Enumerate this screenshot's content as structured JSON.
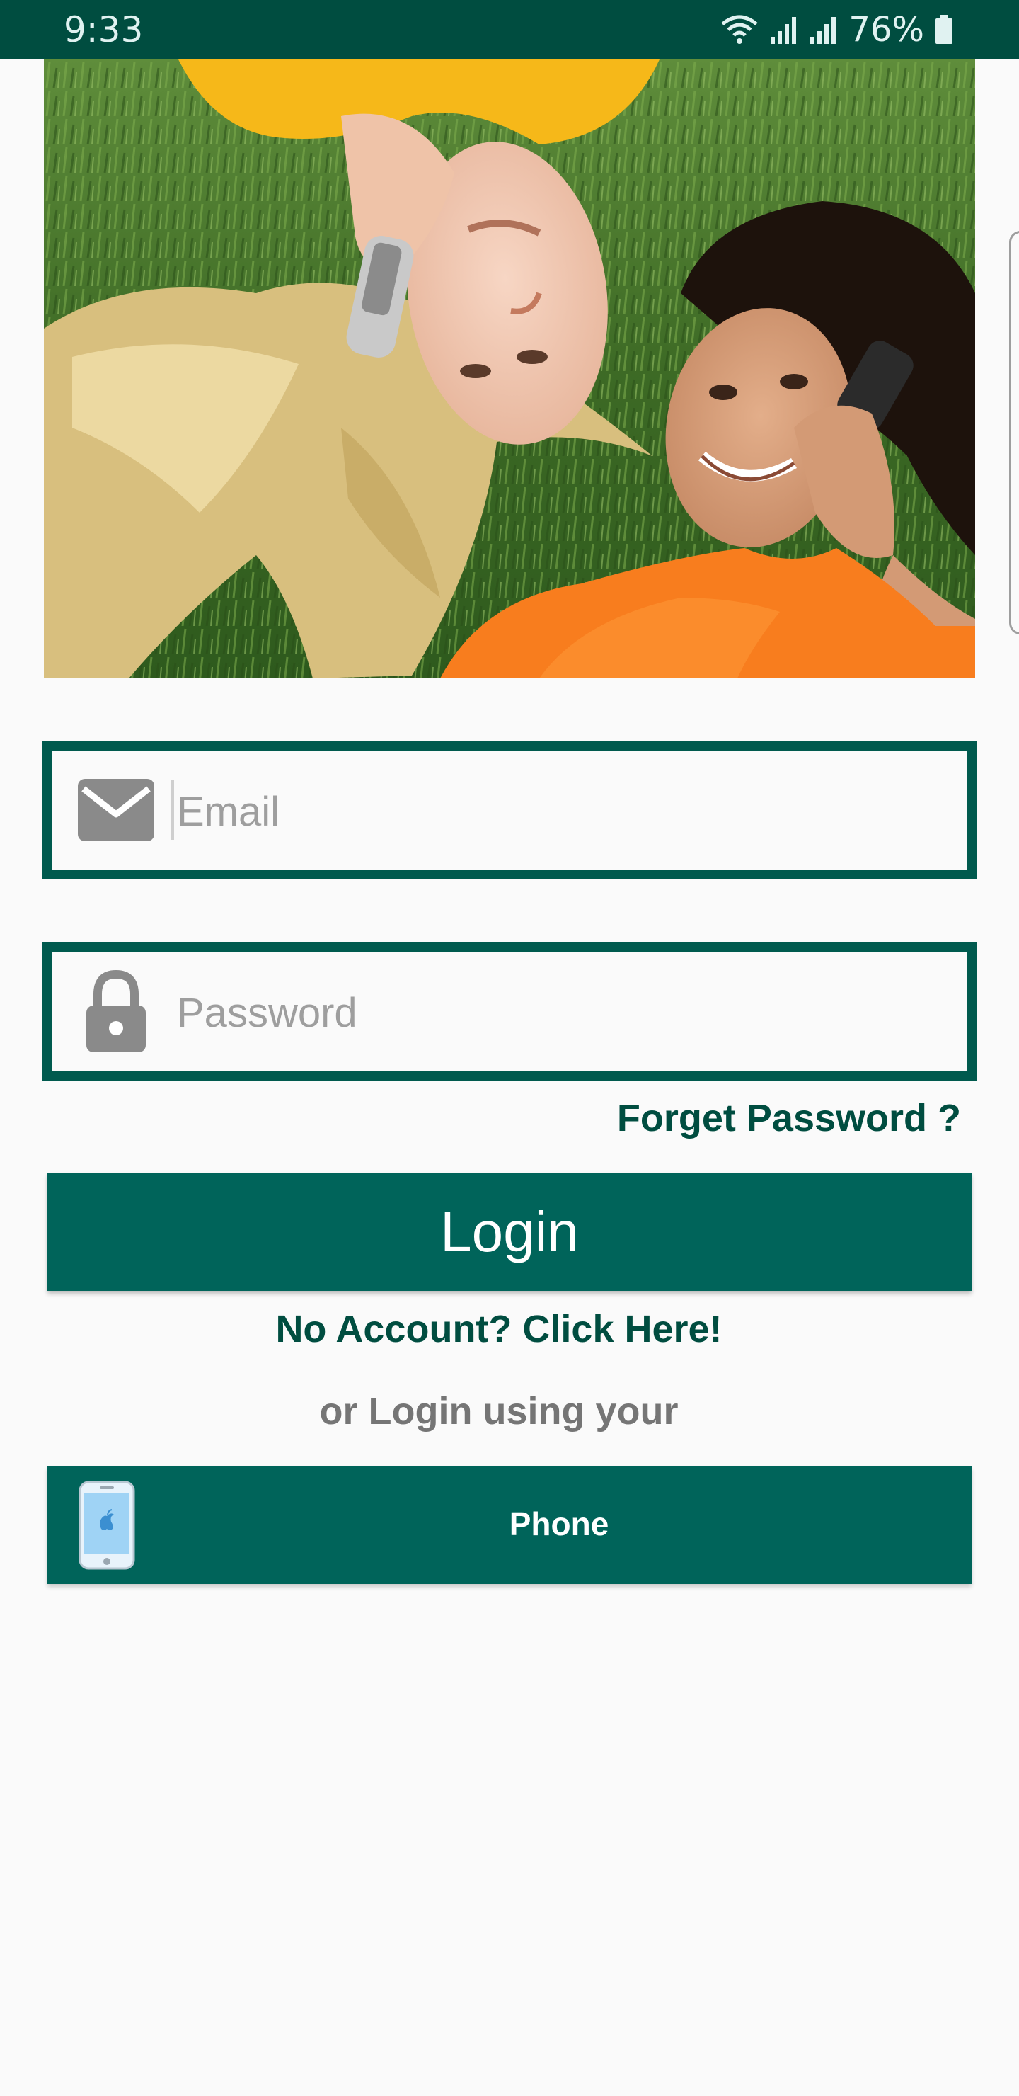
{
  "status_bar": {
    "time": "9:33",
    "battery": "76%",
    "icons": [
      "wifi-icon",
      "signal-icon",
      "signal-icon",
      "battery-icon"
    ]
  },
  "hero": {
    "icon": "couple-on-phones-photo"
  },
  "form": {
    "email": {
      "placeholder": "Email",
      "value": "",
      "icon": "envelope-icon"
    },
    "password": {
      "placeholder": "Password",
      "value": "",
      "icon": "padlock-icon"
    },
    "forget_password_label": "Forget Password ?",
    "login_label": "Login",
    "no_account_label": "No Account? Click Here!",
    "alt_login_label": "or Login using your",
    "phone_button_label": "Phone"
  },
  "colors": {
    "primary_dark": "#004d40",
    "primary": "#00645a",
    "field_border": "#005a4e",
    "background": "#fafafa",
    "muted_text": "#757575"
  }
}
